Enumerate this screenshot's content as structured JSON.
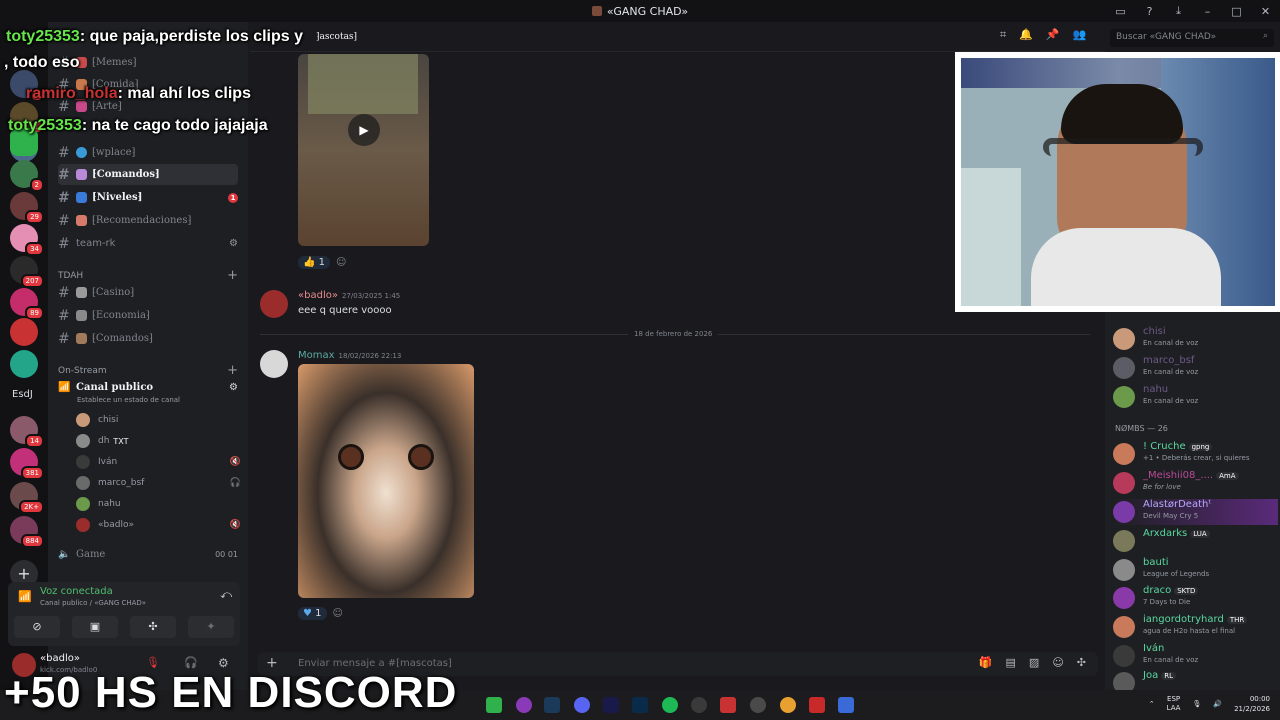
{
  "window": {
    "title": "«GANG CHAD»"
  },
  "header": {
    "search_placeholder": "Buscar «GANG CHAD»",
    "channel_partial": "⁆ascotas⁆"
  },
  "overlay_chat": [
    {
      "user": "toty25353",
      "text": ": que paja,perdiste los clips y"
    },
    {
      "user": "",
      "text": ", todo eso"
    },
    {
      "user": "ramiro_hola",
      "text": ": mal ahí los clips"
    },
    {
      "user": "toty25353",
      "text": ": na te cago todo jajajaja"
    }
  ],
  "servers": {
    "badges": [
      "1",
      "1",
      "2",
      "29",
      "34",
      "207",
      "89",
      "14",
      "381",
      "2K+",
      "884"
    ],
    "text_label": "EsdJ"
  },
  "sidebar": {
    "channels_top": [
      "⁅Memes⁆",
      "⁅Comida⁆",
      "⁅Arte⁆"
    ],
    "channels": [
      {
        "name": "⁅wplace⁆"
      },
      {
        "name": "⁅Comandos⁆"
      },
      {
        "name": "⁅Niveles⁆",
        "badge": "1"
      },
      {
        "name": "⁅Recomendaciones⁆"
      },
      {
        "name": "team-rk"
      }
    ],
    "cat_tdah": "TDAH",
    "tdah_channels": [
      "⁅Casino⁆",
      "⁅Economia⁆",
      "⁅Comandos⁆"
    ],
    "cat_stream": "On-Stream",
    "voice_channel": "Canal publico",
    "voice_status": "Establece un estado de canal",
    "voice_users": [
      {
        "name": "chisi",
        "tag": ""
      },
      {
        "name": "dh",
        "tag": "TXT"
      },
      {
        "name": "Iván",
        "tag": ""
      },
      {
        "name": "marco_bsf",
        "tag": ""
      },
      {
        "name": "nahu",
        "tag": ""
      },
      {
        "name": "«badlo»",
        "tag": ""
      }
    ],
    "game_channel": "Game",
    "game_counts": "00  01"
  },
  "voice_panel": {
    "status": "Voz conectada",
    "location": "Canal publico / «GANG CHAD»"
  },
  "user_panel": {
    "name": "«badlo»",
    "sub": "kick.com/badlo0"
  },
  "messages": {
    "reaction1_count": "1",
    "msg1": {
      "author": "«badlo»",
      "time": "27/03/2025 1:45",
      "text": "eee q quere voooo"
    },
    "date_divider": "18 de febrero de 2026",
    "msg2": {
      "author": "Momax",
      "time": "18/02/2026 22:13"
    },
    "reaction2_count": "1"
  },
  "composer": {
    "placeholder": "Enviar mensaje a #⁅mascotas⁆"
  },
  "members": {
    "voice_list": [
      {
        "name": "chisi",
        "status": "En canal de voz"
      },
      {
        "name": "marco_bsf",
        "status": "En canal de voz"
      },
      {
        "name": "nahu",
        "status": "En canal de voz"
      }
    ],
    "section_label": "NØMBS — 26",
    "list": [
      {
        "name": "! Cruche",
        "tag": "gpng",
        "status": "+1 • Deberás crear, si quieres"
      },
      {
        "name": "_Meishii08_....",
        "tag": "AmA",
        "status": "Be for love"
      },
      {
        "name": "AlastørDeathᵗ",
        "tag": "",
        "status": "Devil May Cry 5"
      },
      {
        "name": "Arxdarks",
        "tag": "LUA",
        "status": ""
      },
      {
        "name": "bauti",
        "tag": "",
        "status": "League of Legends"
      },
      {
        "name": "draco",
        "tag": "SKTD",
        "status": "7 Days to Die"
      },
      {
        "name": "iangordotryhard",
        "tag": "THR",
        "status": "agua de H2o hasta el final"
      },
      {
        "name": "Iván",
        "tag": "",
        "status": "En canal de voz"
      },
      {
        "name": "Joa",
        "tag": "RL",
        "status": ""
      }
    ]
  },
  "caption": "+50 HS EN DISCORD",
  "taskbar": {
    "lang": "ESP",
    "lang2": "LAA",
    "time": "00:00",
    "date": "21/2/2026"
  }
}
